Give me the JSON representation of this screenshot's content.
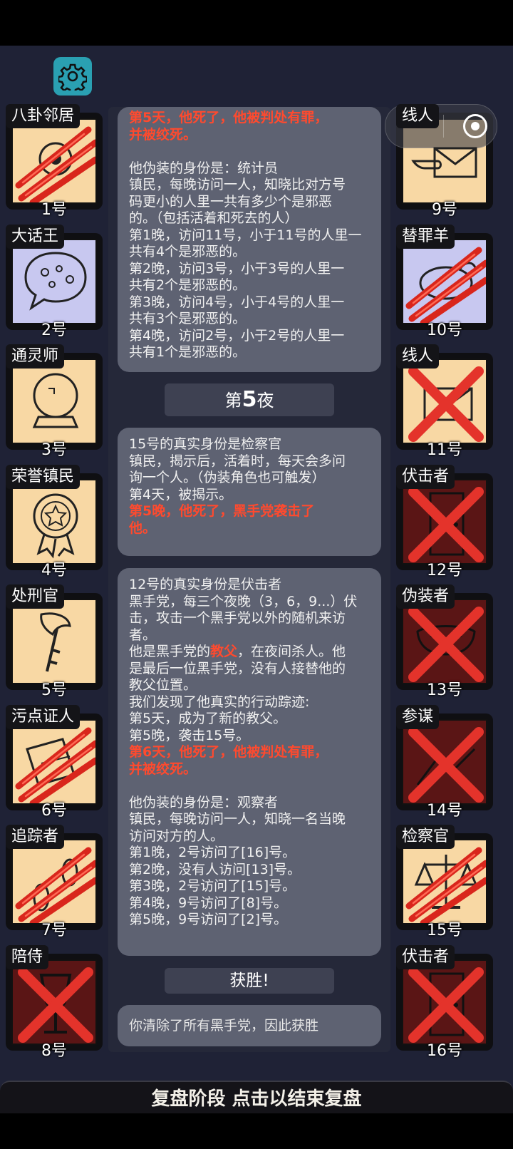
{
  "players_left": [
    {
      "number": "1号",
      "role": "八卦邻居",
      "state": "claw",
      "bg": "tan",
      "icon": "gossip-icon"
    },
    {
      "number": "2号",
      "role": "大话王",
      "state": "alive",
      "bg": "lavender",
      "icon": "speech-bubble-icon"
    },
    {
      "number": "3号",
      "role": "通灵师",
      "state": "alive",
      "bg": "tan",
      "icon": "crystal-ball-icon"
    },
    {
      "number": "4号",
      "role": "荣誉镇民",
      "state": "alive",
      "bg": "tan",
      "icon": "medal-icon"
    },
    {
      "number": "5号",
      "role": "处刑官",
      "state": "alive",
      "bg": "tan",
      "icon": "axe-icon"
    },
    {
      "number": "6号",
      "role": "污点证人",
      "state": "claw",
      "bg": "tan",
      "icon": "papers-icon"
    },
    {
      "number": "7号",
      "role": "追踪者",
      "state": "claw",
      "bg": "tan",
      "icon": "footprints-icon"
    },
    {
      "number": "8号",
      "role": "陪侍",
      "state": "cross",
      "bg": "dark",
      "icon": "wine-glass-icon"
    }
  ],
  "players_right": [
    {
      "number": "9号",
      "role": "线人",
      "state": "alive",
      "bg": "tan",
      "icon": "envelope-hand-icon"
    },
    {
      "number": "10号",
      "role": "替罪羊",
      "state": "claw",
      "bg": "lavender",
      "icon": "goat-icon"
    },
    {
      "number": "11号",
      "role": "线人",
      "state": "cross",
      "bg": "tan",
      "icon": "envelope-icon"
    },
    {
      "number": "12号",
      "role": "伏击者",
      "state": "cross",
      "bg": "dark",
      "icon": "door-icon"
    },
    {
      "number": "13号",
      "role": "伪装者",
      "state": "cross",
      "bg": "dark",
      "icon": "mask-icon"
    },
    {
      "number": "14号",
      "role": "参谋",
      "state": "cross",
      "bg": "dark",
      "icon": "map-icon"
    },
    {
      "number": "15号",
      "role": "检察官",
      "state": "claw",
      "bg": "tan",
      "icon": "scales-icon"
    },
    {
      "number": "16号",
      "role": "伏击者",
      "state": "cross",
      "bg": "dark",
      "icon": "door-icon"
    }
  ],
  "bubble1": [
    {
      "text": "第5天，他死了，他被判处有罪，",
      "red": true
    },
    {
      "text": "并被绞死。",
      "red": true
    },
    {
      "text": "",
      "red": false
    },
    {
      "text": "他伪装的身份是：统计员",
      "red": false
    },
    {
      "text": "镇民，每晚访问一人，知晓比对方号",
      "red": false
    },
    {
      "text": "码更小的人里一共有多少个是邪恶",
      "red": false
    },
    {
      "text": "的。（包括活着和死去的人）",
      "red": false
    },
    {
      "text": "第1晚，访问11号，小于11号的人里一",
      "red": false
    },
    {
      "text": "共有4个是邪恶的。",
      "red": false
    },
    {
      "text": "第2晚，访问3号，小于3号的人里一",
      "red": false
    },
    {
      "text": "共有2个是邪恶的。",
      "red": false
    },
    {
      "text": "第3晚，访问4号，小于4号的人里一",
      "red": false
    },
    {
      "text": "共有3个是邪恶的。",
      "red": false
    },
    {
      "text": "第4晚，访问2号，小于2号的人里一",
      "red": false
    },
    {
      "text": "共有1个是邪恶的。",
      "red": false
    }
  ],
  "night_divider": {
    "prefix": "第",
    "number": "5",
    "suffix": "夜"
  },
  "bubble2": [
    {
      "text": "15号的真实身份是检察官",
      "red": false
    },
    {
      "text": "镇民，揭示后，活着时，每天会多问",
      "red": false
    },
    {
      "text": "询一个人。（伪装角色也可触发）",
      "red": false
    },
    {
      "text": "第4天，被揭示。",
      "red": false
    },
    {
      "text": "第5晚，他死了，黑手党袭击了",
      "red": true
    },
    {
      "text": "他。",
      "red": true
    }
  ],
  "bubble3": [
    {
      "text": "12号的真实身份是伏击者",
      "red": false
    },
    {
      "text": "黑手党，每三个夜晚（3，6，9...）伏",
      "red": false
    },
    {
      "text": "击，攻击一个黑手党以外的随机来访",
      "red": false
    },
    {
      "text": "者。",
      "red": false
    },
    {
      "pre": "他是黑手党的",
      "hl": "教父",
      "post": "，在夜间杀人。他"
    },
    {
      "text": "是最后一位黑手党，没有人接替他的",
      "red": false
    },
    {
      "text": "教父位置。",
      "red": false
    },
    {
      "text": "我们发现了他真实的行动踪迹:",
      "red": false
    },
    {
      "text": "第5天，成为了新的教父。",
      "red": false
    },
    {
      "text": "第5晚，袭击15号。",
      "red": false
    },
    {
      "text": "第6天，他死了，他被判处有罪，",
      "red": true
    },
    {
      "text": "并被绞死。",
      "red": true
    },
    {
      "text": "",
      "red": false
    },
    {
      "text": "他伪装的身份是：观察者",
      "red": false
    },
    {
      "text": "镇民，每晚访问一人，知晓一名当晚",
      "red": false
    },
    {
      "text": "访问对方的人。",
      "red": false
    },
    {
      "text": "第1晚，2号访问了[16]号。",
      "red": false
    },
    {
      "text": "第2晚，没有人访问[13]号。",
      "red": false
    },
    {
      "text": "第3晚，2号访问了[15]号。",
      "red": false
    },
    {
      "text": "第4晚，9号访问了[8]号。",
      "red": false
    },
    {
      "text": "第5晚，9号访问了[2]号。",
      "red": false
    }
  ],
  "victory_title": "获胜!",
  "victory_text": "你清除了所有黑手党，因此获胜",
  "footer_text": "复盘阶段 点击以结束复盘",
  "colors": {
    "highlight_red": "#ff4a2e",
    "card_tan": "#f8d8a4",
    "card_lavender": "#c8c8f0",
    "card_dead": "#5a1515",
    "settings_teal": "#2aa0b2"
  }
}
